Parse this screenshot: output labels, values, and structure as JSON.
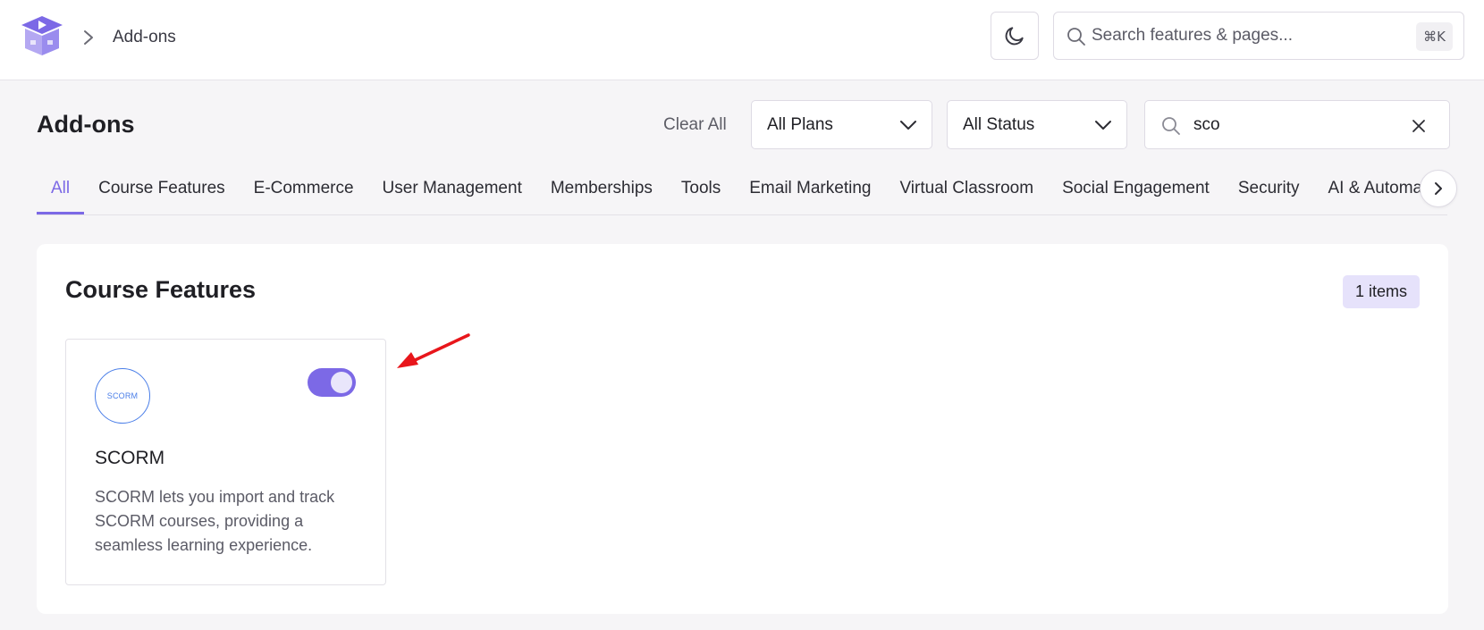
{
  "header": {
    "breadcrumb_current": "Add-ons",
    "search_placeholder": "Search features & pages...",
    "search_shortcut": "⌘K",
    "icons": {
      "logo": "graduation-cap-play-logo",
      "theme": "moon-icon",
      "search": "search-icon",
      "breadcrumb": "chevron-right-icon"
    }
  },
  "toolbar": {
    "title": "Add-ons",
    "clear_all_label": "Clear All",
    "plans_select": {
      "selected": "All Plans"
    },
    "status_select": {
      "selected": "All Status"
    },
    "search_value": "sco"
  },
  "tabs": [
    {
      "label": "All",
      "active": true
    },
    {
      "label": "Course Features"
    },
    {
      "label": "E-Commerce"
    },
    {
      "label": "User Management"
    },
    {
      "label": "Memberships"
    },
    {
      "label": "Tools"
    },
    {
      "label": "Email Marketing"
    },
    {
      "label": "Virtual Classroom"
    },
    {
      "label": "Social Engagement"
    },
    {
      "label": "Security"
    },
    {
      "label": "AI & Automation"
    }
  ],
  "section": {
    "title": "Course Features",
    "count_label": "1 items",
    "addons": [
      {
        "logo_text": "SCORM",
        "name": "SCORM",
        "description": "SCORM lets you import and track SCORM courses, providing a seamless learning experience.",
        "enabled": true
      }
    ]
  },
  "colors": {
    "accent": "#7c69e6",
    "badge_bg": "#e6e2fb",
    "annotation_arrow": "#e8161b",
    "scorm_blue": "#4a7ee8"
  }
}
